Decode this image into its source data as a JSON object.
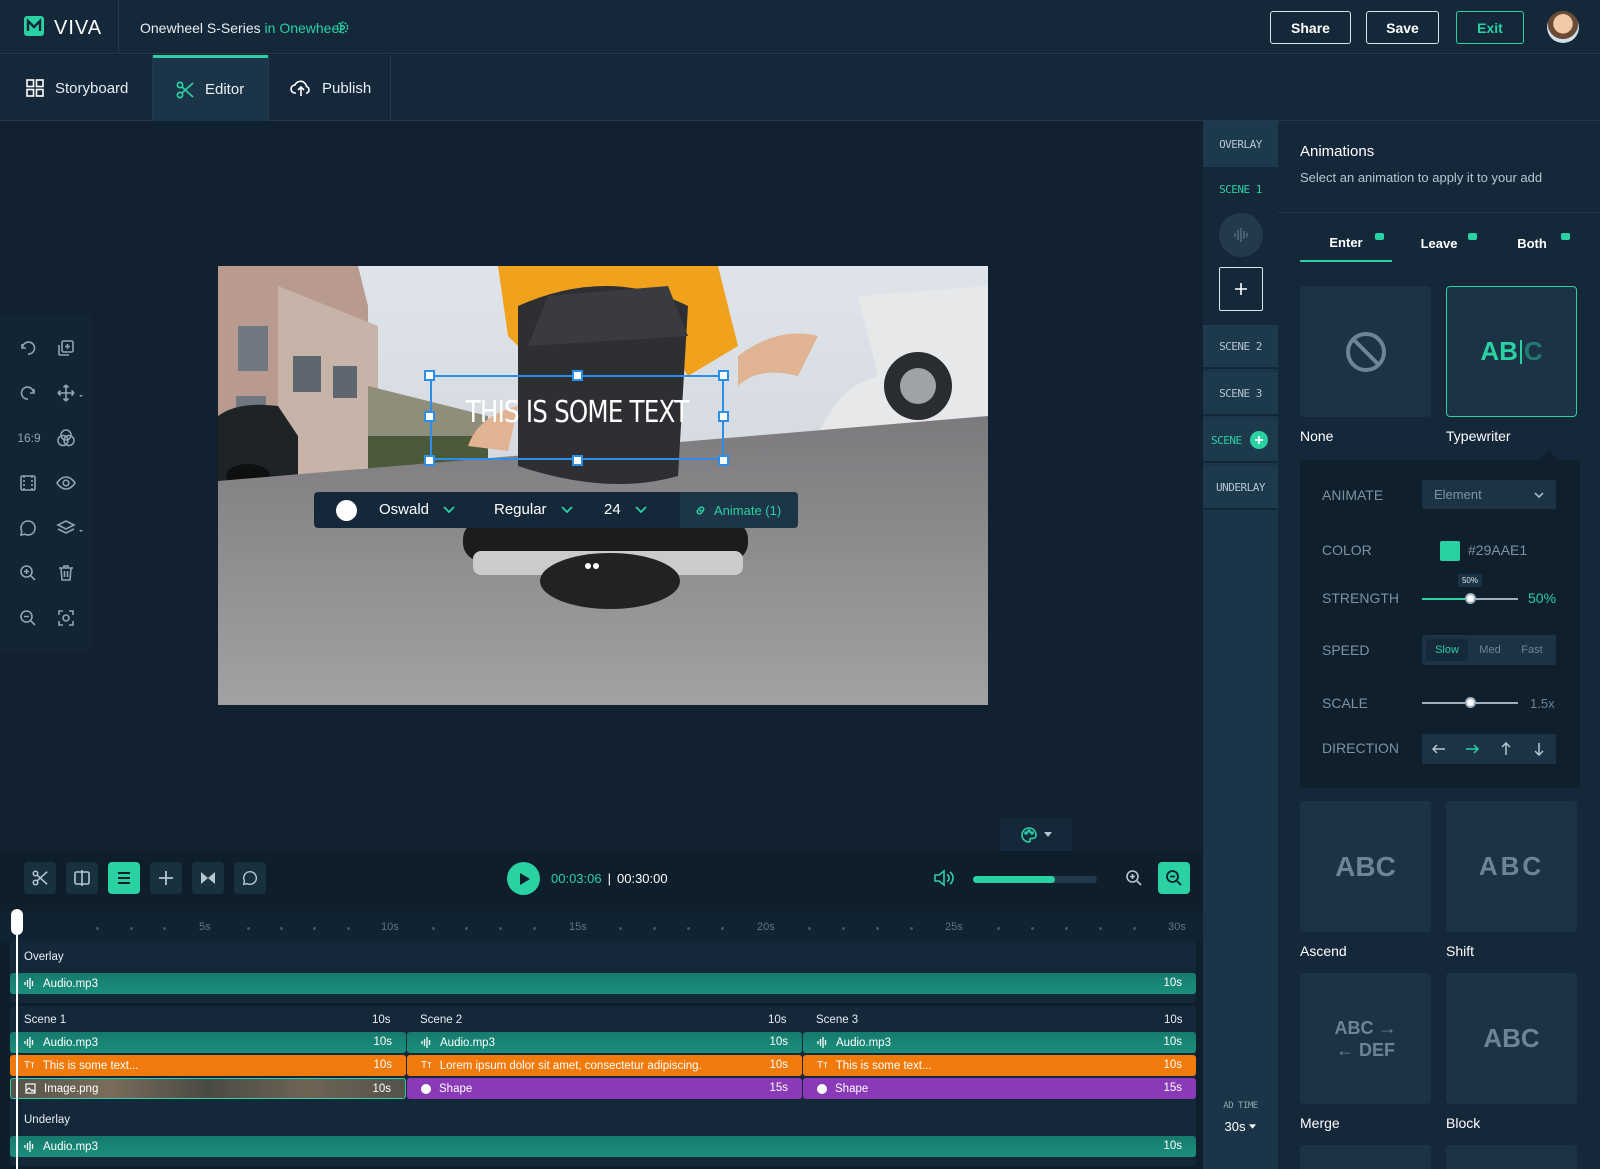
{
  "colors": {
    "accent": "#2ad1a3",
    "orange": "#f07a0c",
    "purple": "#8a3ab6",
    "teal_track": "#1a8f7c"
  },
  "header": {
    "brand": "VIVA",
    "project_name": "Onewheel S-Series",
    "project_in": "in",
    "project_folder": "Onewheel",
    "share": "Share",
    "save": "Save",
    "exit": "Exit"
  },
  "nav": {
    "storyboard": "Storyboard",
    "editor": "Editor",
    "publish": "Publish"
  },
  "left_tools": {
    "ratio": "16:9"
  },
  "canvas": {
    "text": "THIS IS SOME TEXT",
    "font": "Oswald",
    "weight": "Regular",
    "size": "24",
    "animate": "Animate (1)"
  },
  "timeline": {
    "current": "00:03:06",
    "sep": "|",
    "total": "00:30:00",
    "volume_fraction": 0.66,
    "ruler": [
      "5s",
      "10s",
      "15s",
      "20s",
      "25s",
      "30s"
    ],
    "overlay": {
      "label": "Overlay",
      "audio": "Audio.mp3",
      "dur": "10s"
    },
    "scenes": [
      {
        "label": "Scene 1",
        "dur": "10s",
        "audio": "Audio.mp3",
        "audio_dur": "10s",
        "text": "This is some text...",
        "text_dur": "10s",
        "third": "Image.png",
        "third_dur": "10s"
      },
      {
        "label": "Scene 2",
        "dur": "10s",
        "audio": "Audio.mp3",
        "audio_dur": "10s",
        "text": "Lorem ipsum dolor sit amet, consectetur adipiscing.",
        "text_dur": "10s",
        "third": "Shape",
        "third_dur": "15s"
      },
      {
        "label": "Scene 3",
        "dur": "10s",
        "audio": "Audio.mp3",
        "audio_dur": "10s",
        "text": "This is some text...",
        "text_dur": "10s",
        "third": "Shape",
        "third_dur": "15s"
      }
    ],
    "underlay": {
      "label": "Underlay",
      "audio": "Audio.mp3",
      "dur": "10s"
    }
  },
  "scene_column": {
    "overlay": "OVERLAY",
    "scene1": "SCENE 1",
    "scene2": "SCENE 2",
    "scene3": "SCENE 3",
    "scene_add": "SCENE",
    "underlay": "UNDERLAY",
    "ad_time_label": "AD TIME",
    "ad_time_value": "30s"
  },
  "animations": {
    "title": "Animations",
    "subtitle": "Select an animation to apply it to your add",
    "tabs": [
      "Enter",
      "Leave",
      "Both"
    ],
    "cards": {
      "none": "None",
      "typewriter": "Typewriter",
      "typewriter_glyph_a": "AB",
      "typewriter_glyph_b": "C",
      "ascend": "Ascend",
      "ascend_glyph": "ABC",
      "shift": "Shift",
      "shift_glyph": "ABC",
      "merge": "Merge",
      "merge_glyph_1": "ABC →",
      "merge_glyph_2": "← DEF",
      "block": "Block",
      "block_glyph": "ABC"
    },
    "detail": {
      "animate_label": "ANIMATE",
      "animate_value": "Element",
      "color_label": "COLOR",
      "color_value": "#29AAE1",
      "color_swatch": "#2ad1a3",
      "strength_label": "STRENGTH",
      "strength_tip": "50%",
      "strength_value": "50%",
      "strength_fraction": 0.5,
      "speed_label": "SPEED",
      "speed_options": [
        "Slow",
        "Med",
        "Fast"
      ],
      "speed_selected": "Slow",
      "scale_label": "SCALE",
      "scale_value": "1.5x",
      "scale_fraction": 0.5,
      "direction_label": "DIRECTION",
      "direction_selected": "right"
    }
  }
}
